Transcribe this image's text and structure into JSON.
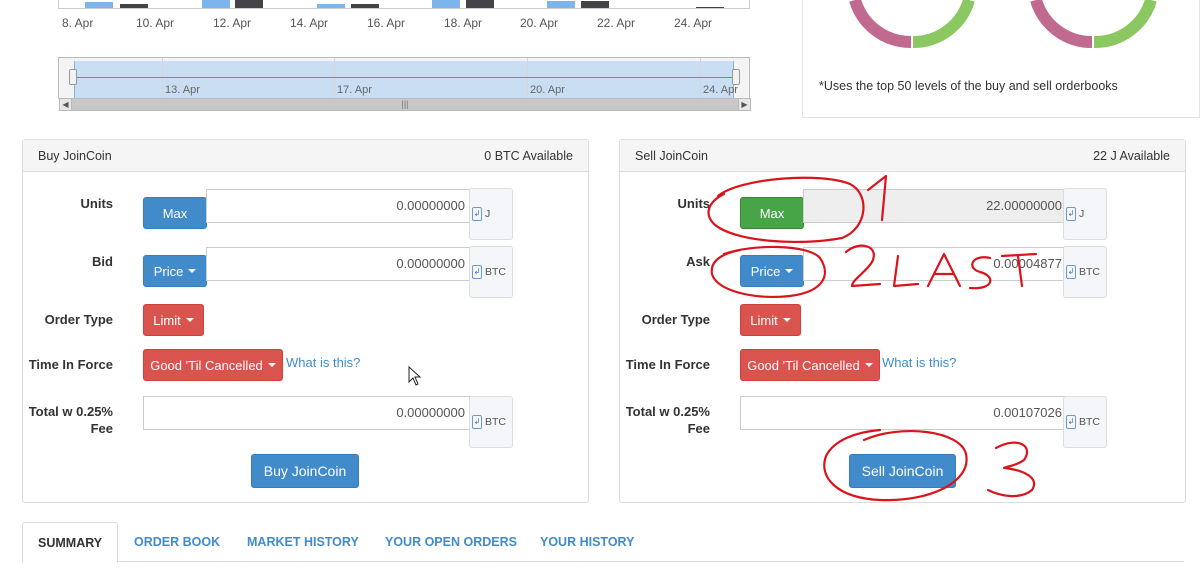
{
  "chart": {
    "x_ticks": [
      "8. Apr",
      "10. Apr",
      "12. Apr",
      "14. Apr",
      "16. Apr",
      "18. Apr",
      "20. Apr",
      "22. Apr",
      "24. Apr"
    ],
    "navigator_labels": [
      "13. Apr",
      "17. Apr",
      "20. Apr",
      "24. Apr"
    ],
    "colors": {
      "series_a": "#7cb5ec",
      "series_b": "#434348",
      "bid_ring": "#c06a8f",
      "ask_ring": "#8cc862"
    }
  },
  "donut": {
    "note": "*Uses the top 50 levels of the buy and sell orderbooks"
  },
  "buy": {
    "title": "Buy JoinCoin",
    "available": "0 BTC Available",
    "units_label": "Units",
    "max_label": "Max",
    "units_value": "0.00000000",
    "units_currency": "J",
    "bid_label": "Bid",
    "price_label": "Price",
    "bid_value": "0.00000000",
    "bid_currency": "BTC",
    "order_type_label": "Order Type",
    "order_type_value": "Limit",
    "tif_label": "Time In Force",
    "tif_value": "Good 'Til Cancelled",
    "tif_help": "What is this?",
    "total_label": "Total w 0.25% Fee",
    "total_value": "0.00000000",
    "total_currency": "BTC",
    "submit_label": "Buy JoinCoin"
  },
  "sell": {
    "title": "Sell JoinCoin",
    "available": "22 J Available",
    "units_label": "Units",
    "max_label": "Max",
    "units_value": "22.00000000",
    "units_currency": "J",
    "ask_label": "Ask",
    "price_label": "Price",
    "ask_value": "0.00004877",
    "ask_currency": "BTC",
    "order_type_label": "Order Type",
    "order_type_value": "Limit",
    "tif_label": "Time In Force",
    "tif_value": "Good 'Til Cancelled",
    "tif_help": "What is this?",
    "total_label": "Total w 0.25% Fee",
    "total_value": "0.00107026",
    "total_currency": "BTC",
    "submit_label": "Sell JoinCoin"
  },
  "annotations": {
    "step1": "1",
    "step2": "2LAST",
    "step3": "3",
    "color": "#d9141a"
  },
  "tabs": [
    {
      "label": "SUMMARY",
      "active": true
    },
    {
      "label": "ORDER BOOK",
      "active": false
    },
    {
      "label": "MARKET HISTORY",
      "active": false
    },
    {
      "label": "YOUR OPEN ORDERS",
      "active": false
    },
    {
      "label": "YOUR HISTORY",
      "active": false
    }
  ]
}
